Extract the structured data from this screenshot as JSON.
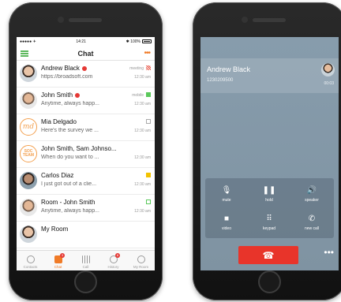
{
  "chat_app": {
    "status": {
      "carrier": "●●●●● ✈",
      "time": "14:21",
      "battery": "✱ 100%"
    },
    "title": "Chat",
    "conversations": [
      {
        "name": "Andrew Black",
        "preview": "https://broadsoft.com",
        "meta": "meeting",
        "time": "12:30 am",
        "avatar_type": "photo"
      },
      {
        "name": "John Smith",
        "preview": "Anytime, always happ...",
        "meta": "mobile",
        "time": "12:30 am",
        "avatar_type": "photo"
      },
      {
        "name": "Mia Delgado",
        "preview": "Here's the survey we ...",
        "meta": "",
        "time": "12:30 am",
        "avatar_type": "text",
        "avatar_text": "md"
      },
      {
        "name": "John Smith, Sam Johnso...",
        "preview": "When do you want to ...",
        "meta": "",
        "time": "12:30 am",
        "avatar_type": "text",
        "avatar_text": "SOC TEAM"
      },
      {
        "name": "Carlos Diaz",
        "preview": "I just got out of a clie...",
        "meta": "",
        "time": "12:30 am",
        "avatar_type": "photo"
      },
      {
        "name": "Room - John Smith",
        "preview": "Anytime, always happ...",
        "meta": "",
        "time": "12:30 am",
        "avatar_type": "photo"
      },
      {
        "name": "My Room",
        "preview": "",
        "meta": "",
        "time": "",
        "avatar_type": "photo"
      }
    ],
    "tabs": [
      {
        "label": "Contacts",
        "icon": "contacts-icon",
        "badge": ""
      },
      {
        "label": "Chat",
        "icon": "chat-icon",
        "badge": "3"
      },
      {
        "label": "Call",
        "icon": "keypad-icon",
        "badge": ""
      },
      {
        "label": "History",
        "icon": "history-icon",
        "badge": "8"
      },
      {
        "label": "My Room",
        "icon": "room-icon",
        "badge": ""
      }
    ]
  },
  "call_app": {
    "caller_name": "Andrew Black",
    "caller_number": "1230209500",
    "duration": "00:03",
    "controls": [
      {
        "label": "mute",
        "glyph": "🎙"
      },
      {
        "label": "hold",
        "glyph": "❚❚"
      },
      {
        "label": "speaker",
        "glyph": "🔊"
      },
      {
        "label": "video",
        "glyph": "■"
      },
      {
        "label": "keypad",
        "glyph": "⠿"
      },
      {
        "label": "new call",
        "glyph": "✆"
      }
    ],
    "end_call_glyph": "☎",
    "more_glyph": "•••"
  },
  "colors": {
    "accent": "#f07b27",
    "end_call": "#e8342a",
    "call_bg": "#879cac"
  }
}
